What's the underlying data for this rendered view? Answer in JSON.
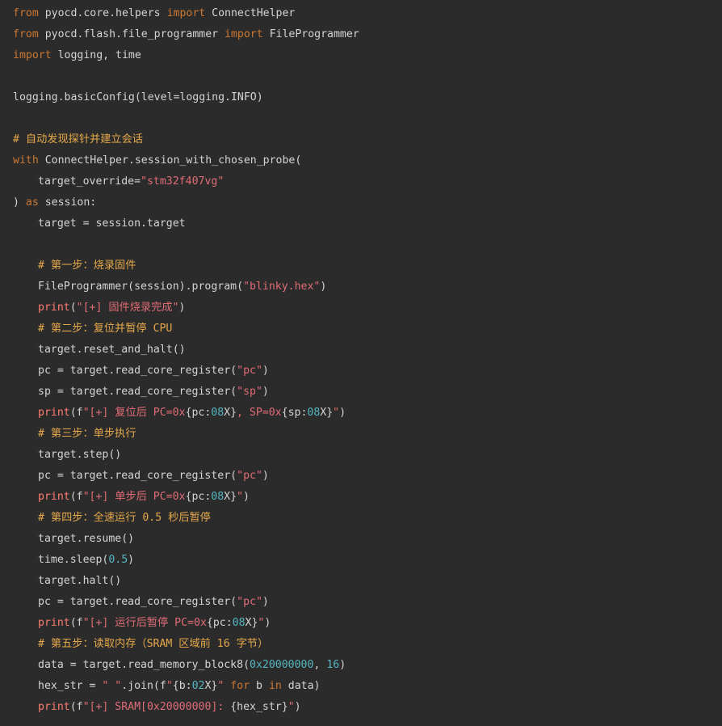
{
  "code": {
    "lines": [
      [
        {
          "t": "kw",
          "v": "from"
        },
        {
          "t": "tx",
          "v": " pyocd.core.helpers "
        },
        {
          "t": "kw",
          "v": "import"
        },
        {
          "t": "tx",
          "v": " ConnectHelper"
        }
      ],
      [
        {
          "t": "kw",
          "v": "from"
        },
        {
          "t": "tx",
          "v": " pyocd.flash.file_programmer "
        },
        {
          "t": "kw",
          "v": "import"
        },
        {
          "t": "tx",
          "v": " FileProgrammer"
        }
      ],
      [
        {
          "t": "kw",
          "v": "import"
        },
        {
          "t": "tx",
          "v": " logging, time"
        }
      ],
      [],
      [
        {
          "t": "tx",
          "v": "logging.basicConfig(level=logging.INFO)"
        }
      ],
      [],
      [
        {
          "t": "cm",
          "v": "# 自动发现探针并建立会话"
        }
      ],
      [
        {
          "t": "kw",
          "v": "with"
        },
        {
          "t": "tx",
          "v": " ConnectHelper.session_with_chosen_probe("
        }
      ],
      [
        {
          "t": "ind"
        },
        {
          "t": "tx",
          "v": "target_override="
        },
        {
          "t": "str",
          "v": "\"stm32f407vg\""
        }
      ],
      [
        {
          "t": "tx",
          "v": ") "
        },
        {
          "t": "kw",
          "v": "as"
        },
        {
          "t": "tx",
          "v": " session:"
        }
      ],
      [
        {
          "t": "ind"
        },
        {
          "t": "tx",
          "v": "target = session.target"
        }
      ],
      [],
      [
        {
          "t": "ind"
        },
        {
          "t": "cm",
          "v": "# 第一步：烧录固件"
        }
      ],
      [
        {
          "t": "ind"
        },
        {
          "t": "tx",
          "v": "FileProgrammer(session).program("
        },
        {
          "t": "str",
          "v": "\"blinky.hex\""
        },
        {
          "t": "tx",
          "v": ")"
        }
      ],
      [
        {
          "t": "ind"
        },
        {
          "t": "bi",
          "v": "print"
        },
        {
          "t": "tx",
          "v": "("
        },
        {
          "t": "str",
          "v": "\"[+] 固件烧录完成\""
        },
        {
          "t": "tx",
          "v": ")"
        }
      ],
      [
        {
          "t": "ind"
        },
        {
          "t": "cm",
          "v": "# 第二步：复位并暂停 CPU"
        }
      ],
      [
        {
          "t": "ind"
        },
        {
          "t": "tx",
          "v": "target.reset_and_halt()"
        }
      ],
      [
        {
          "t": "ind"
        },
        {
          "t": "tx",
          "v": "pc = target.read_core_register("
        },
        {
          "t": "str",
          "v": "\"pc\""
        },
        {
          "t": "tx",
          "v": ")"
        }
      ],
      [
        {
          "t": "ind"
        },
        {
          "t": "tx",
          "v": "sp = target.read_core_register("
        },
        {
          "t": "str",
          "v": "\"sp\""
        },
        {
          "t": "tx",
          "v": ")"
        }
      ],
      [
        {
          "t": "ind"
        },
        {
          "t": "bi",
          "v": "print"
        },
        {
          "t": "tx",
          "v": "(f"
        },
        {
          "t": "str",
          "v": "\"[+] 复位后 PC=0x"
        },
        {
          "t": "fmt",
          "v": "{pc:"
        },
        {
          "t": "num",
          "v": "08"
        },
        {
          "t": "fmt",
          "v": "X}"
        },
        {
          "t": "str",
          "v": ", SP=0x"
        },
        {
          "t": "fmt",
          "v": "{sp:"
        },
        {
          "t": "num",
          "v": "08"
        },
        {
          "t": "fmt",
          "v": "X}"
        },
        {
          "t": "str",
          "v": "\""
        },
        {
          "t": "tx",
          "v": ")"
        }
      ],
      [
        {
          "t": "ind"
        },
        {
          "t": "cm",
          "v": "# 第三步：单步执行"
        }
      ],
      [
        {
          "t": "ind"
        },
        {
          "t": "tx",
          "v": "target.step()"
        }
      ],
      [
        {
          "t": "ind"
        },
        {
          "t": "tx",
          "v": "pc = target.read_core_register("
        },
        {
          "t": "str",
          "v": "\"pc\""
        },
        {
          "t": "tx",
          "v": ")"
        }
      ],
      [
        {
          "t": "ind"
        },
        {
          "t": "bi",
          "v": "print"
        },
        {
          "t": "tx",
          "v": "(f"
        },
        {
          "t": "str",
          "v": "\"[+] 单步后 PC=0x"
        },
        {
          "t": "fmt",
          "v": "{pc:"
        },
        {
          "t": "num",
          "v": "08"
        },
        {
          "t": "fmt",
          "v": "X}"
        },
        {
          "t": "str",
          "v": "\""
        },
        {
          "t": "tx",
          "v": ")"
        }
      ],
      [
        {
          "t": "ind"
        },
        {
          "t": "cm",
          "v": "# 第四步：全速运行 0.5 秒后暂停"
        }
      ],
      [
        {
          "t": "ind"
        },
        {
          "t": "tx",
          "v": "target.resume()"
        }
      ],
      [
        {
          "t": "ind"
        },
        {
          "t": "tx",
          "v": "time.sleep("
        },
        {
          "t": "num",
          "v": "0.5"
        },
        {
          "t": "tx",
          "v": ")"
        }
      ],
      [
        {
          "t": "ind"
        },
        {
          "t": "tx",
          "v": "target.halt()"
        }
      ],
      [
        {
          "t": "ind"
        },
        {
          "t": "tx",
          "v": "pc = target.read_core_register("
        },
        {
          "t": "str",
          "v": "\"pc\""
        },
        {
          "t": "tx",
          "v": ")"
        }
      ],
      [
        {
          "t": "ind"
        },
        {
          "t": "bi",
          "v": "print"
        },
        {
          "t": "tx",
          "v": "(f"
        },
        {
          "t": "str",
          "v": "\"[+] 运行后暂停 PC=0x"
        },
        {
          "t": "fmt",
          "v": "{pc:"
        },
        {
          "t": "num",
          "v": "08"
        },
        {
          "t": "fmt",
          "v": "X}"
        },
        {
          "t": "str",
          "v": "\""
        },
        {
          "t": "tx",
          "v": ")"
        }
      ],
      [
        {
          "t": "ind"
        },
        {
          "t": "cm",
          "v": "# 第五步：读取内存（SRAM 区域前 16 字节）"
        }
      ],
      [
        {
          "t": "ind"
        },
        {
          "t": "tx",
          "v": "data = target.read_memory_block8("
        },
        {
          "t": "num",
          "v": "0x20000000"
        },
        {
          "t": "tx",
          "v": ", "
        },
        {
          "t": "num",
          "v": "16"
        },
        {
          "t": "tx",
          "v": ")"
        }
      ],
      [
        {
          "t": "ind"
        },
        {
          "t": "tx",
          "v": "hex_str = "
        },
        {
          "t": "str",
          "v": "\" \""
        },
        {
          "t": "tx",
          "v": ".join(f"
        },
        {
          "t": "str",
          "v": "\""
        },
        {
          "t": "fmt",
          "v": "{b:"
        },
        {
          "t": "num",
          "v": "02"
        },
        {
          "t": "fmt",
          "v": "X}"
        },
        {
          "t": "str",
          "v": "\""
        },
        {
          "t": "tx",
          "v": " "
        },
        {
          "t": "kw",
          "v": "for"
        },
        {
          "t": "tx",
          "v": " b "
        },
        {
          "t": "kw",
          "v": "in"
        },
        {
          "t": "tx",
          "v": " data)"
        }
      ],
      [
        {
          "t": "ind"
        },
        {
          "t": "bi",
          "v": "print"
        },
        {
          "t": "tx",
          "v": "(f"
        },
        {
          "t": "str",
          "v": "\"[+] SRAM[0x20000000]: "
        },
        {
          "t": "fmt",
          "v": "{hex_str}"
        },
        {
          "t": "str",
          "v": "\""
        },
        {
          "t": "tx",
          "v": ")"
        }
      ]
    ]
  },
  "colors": {
    "background": "#2b2b2b",
    "keyword": "#cc7832",
    "builtin": "#ff7b72",
    "string": "#e06c75",
    "number": "#56b6c2",
    "comment": "#e5a84b",
    "text": "#d4d4d4"
  }
}
